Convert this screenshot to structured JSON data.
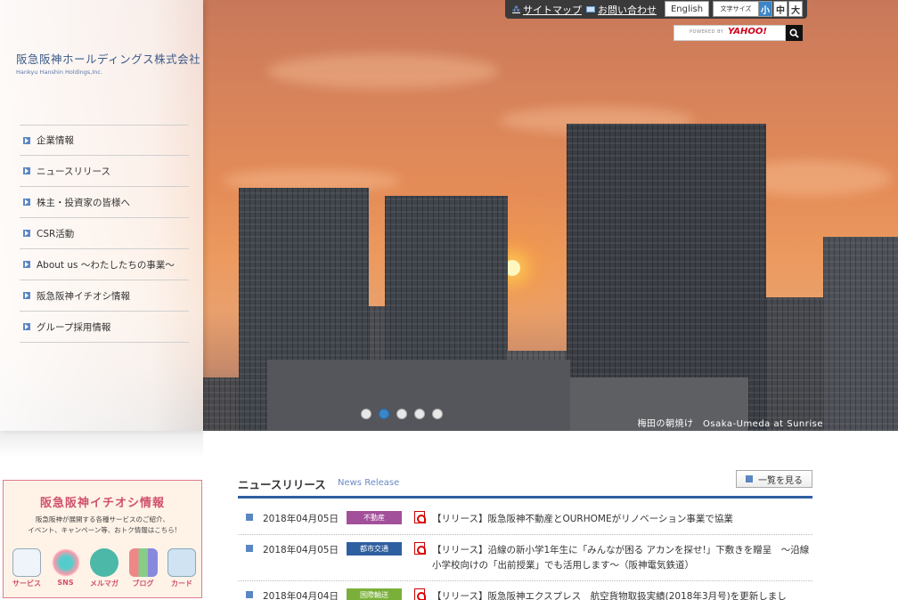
{
  "company": {
    "name_jp": "阪急阪神ホールディングス株式会社",
    "name_en": "Hankyu Hanshin Holdings,Inc."
  },
  "nav": {
    "items": [
      {
        "label": "企業情報"
      },
      {
        "label": "ニュースリリース"
      },
      {
        "label": "株主・投資家の皆様へ"
      },
      {
        "label": "CSR活動"
      },
      {
        "label": "About us ～わたしたちの事業～"
      },
      {
        "label": "阪急阪神イチオシ情報"
      },
      {
        "label": "グループ採用情報"
      }
    ]
  },
  "topbar": {
    "sitemap": "サイトマップ",
    "contact": "お問い合わせ",
    "english": "English",
    "fontsize_label": "文字サイズ",
    "fontsize_small": "小",
    "fontsize_medium": "中",
    "fontsize_large": "大"
  },
  "search": {
    "powered_by": "POWERED BY",
    "brand": "YAHOO!"
  },
  "hero": {
    "caption": "梅田の朝焼け　Osaka-Umeda at Sunrise",
    "slide_count": 5,
    "active_slide": 2
  },
  "banner": {
    "title": "阪急阪神イチオシ情報",
    "sub_line1": "阪急阪神が展開する各種サービスのご紹介、",
    "sub_line2": "イベント、キャンペーン等、おトク情報はこちら!",
    "icons": [
      {
        "label": "サービス",
        "icon": "service-icon"
      },
      {
        "label": "SNS",
        "icon": "sns-icon"
      },
      {
        "label": "メルマガ",
        "icon": "mail-icon"
      },
      {
        "label": "ブログ",
        "icon": "blog-icon"
      },
      {
        "label": "カード",
        "icon": "card-icon"
      }
    ]
  },
  "news": {
    "title": "ニュースリリース",
    "title_en": "News Release",
    "view_all": "一覧を見る",
    "items": [
      {
        "date": "2018年04月05日",
        "tag": "不動産",
        "tag_color": "#a2509a",
        "text": "【リリース】阪急阪神不動産とOURHOMEがリノベーション事業で協業"
      },
      {
        "date": "2018年04月05日",
        "tag": "都市交通",
        "tag_color": "#2e5fa0",
        "text": "【リリース】沿線の新小学1年生に「みんなが困る アカンを探せ!」下敷きを贈呈　～沿線小学校向けの「出前授業」でも活用します～（阪神電気鉄道）"
      },
      {
        "date": "2018年04月04日",
        "tag": "国際輸送",
        "tag_color": "#7ab03a",
        "text": "【リリース】阪急阪神エクスプレス　航空貨物取扱実績(2018年3月号)を更新しまし"
      }
    ]
  },
  "colors": {
    "accent_blue": "#2e5fa0",
    "nav_square": "#5b86c4",
    "banner_pink": "#d0506b"
  }
}
